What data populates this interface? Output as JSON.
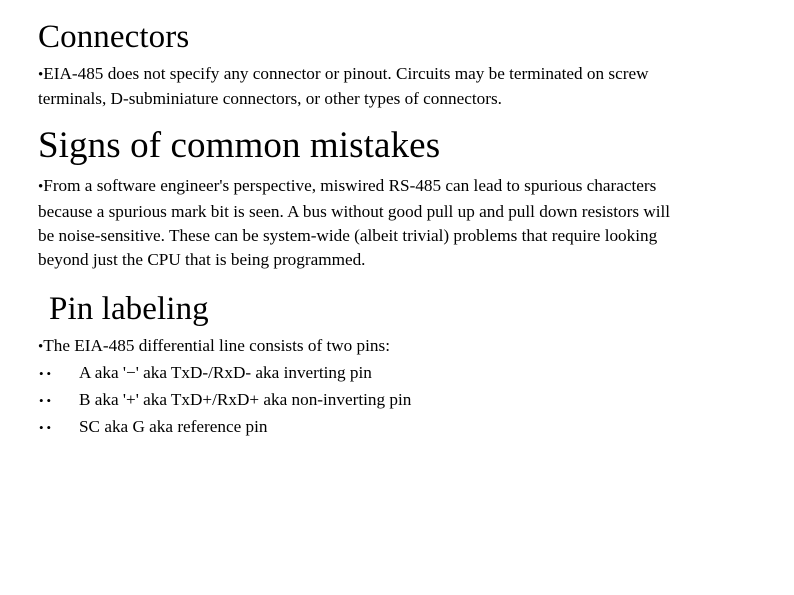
{
  "slide": {
    "background_color": "#ffffff",
    "text_color": "#000000",
    "sections": {
      "connectors": {
        "heading": "Connectors",
        "bullet_marker": "•",
        "body": "EIA-485 does not specify any connector or pinout. Circuits may be terminated on screw terminals, D-subminiature connectors, or other types of connectors."
      },
      "mistakes": {
        "heading": "Signs of common mistakes",
        "bullet_marker": "•",
        "body": "From a software engineer's perspective, miswired RS-485 can lead to spurious characters because a spurious mark bit is seen. A bus without good pull up and pull down resistors will be noise-sensitive. These can be system-wide (albeit trivial) problems that require looking beyond just the CPU that is being programmed."
      },
      "pin_labeling": {
        "heading": "Pin labeling",
        "bullet_marker": "•",
        "intro": "The EIA-485 differential line consists of two pins:",
        "sub_marker": "••",
        "items": [
          "A aka '−' aka TxD-/RxD- aka inverting pin",
          "B aka '+' aka TxD+/RxD+ aka non-inverting pin",
          "SC aka G aka reference pin"
        ]
      }
    }
  }
}
